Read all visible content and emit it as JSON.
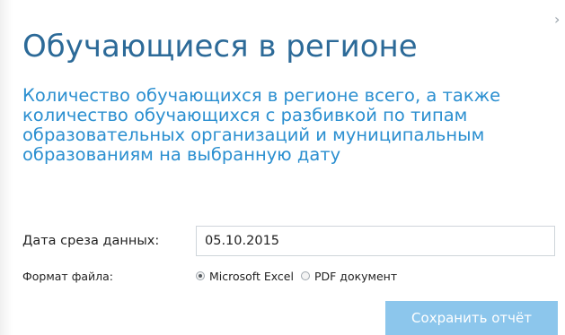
{
  "dialog": {
    "title": "Обучающиеся в регионе",
    "description": "Количество обучающихся в регионе всего, а также количество обучающихся с разбивкой по типам образовательных организаций и муниципальным образованиям на выбранную дату",
    "close_icon": "chevron-right-icon",
    "close_glyph": "›"
  },
  "form": {
    "date_label": "Дата среза данных:",
    "date_value": "05.10.2015",
    "format_label": "Формат файла:",
    "formats": [
      {
        "label": "Microsoft Excel",
        "checked": true
      },
      {
        "label": "PDF документ",
        "checked": false
      }
    ]
  },
  "actions": {
    "save_label": "Сохранить отчёт"
  },
  "colors": {
    "title": "#2c6a98",
    "description": "#2b8fd0",
    "button": "#8cc6ec"
  }
}
